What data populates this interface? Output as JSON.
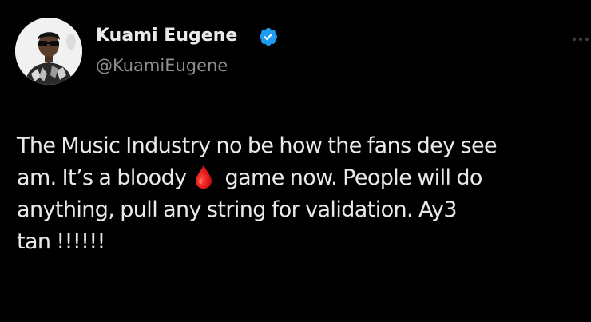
{
  "author": {
    "display_name": "Kuami Eugene",
    "handle": "@KuamiEugene",
    "verified_icon": "verified-badge-icon",
    "avatar_icon": "profile-photo"
  },
  "tweet": {
    "line1": "The Music Industry no be how the fans dey see",
    "line2_before_emoji": "am. It’s a bloody",
    "emoji": "drop-of-blood-icon",
    "line2_after_emoji": "game now. People will do",
    "line3": "anything, pull any string for validation. Ay3",
    "line4": "tan !!!!!!"
  },
  "menu": {
    "icon": "more-options-icon"
  },
  "colors": {
    "background": "#000000",
    "primary_text": "#e7e9ea",
    "secondary_text": "#8b8f93",
    "verified_blue": "#1d9bf0",
    "blood_red": "#dd1a1a"
  }
}
